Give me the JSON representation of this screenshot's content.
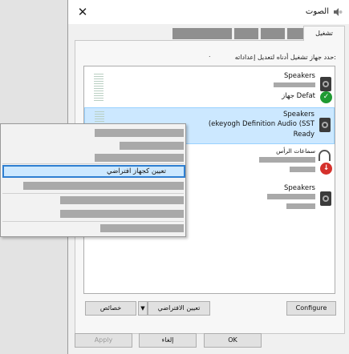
{
  "window": {
    "title": "الصوت"
  },
  "tabs": {
    "active_label": "تشغيل"
  },
  "panel": {
    "instructions": "حدد جهاز تشغيل أدناه لتعديل إعداداته:",
    "instruction_dot": "."
  },
  "devices": [
    {
      "name": "Speakers",
      "status": "جهاز Defat"
    },
    {
      "name": "Speakers",
      "detail": "(ekeyogh Definition Audio (SST",
      "status": "Ready"
    },
    {
      "name": "سماعات الرأس"
    },
    {
      "name": "Speakers"
    }
  ],
  "context_menu": {
    "highlighted_item": "تعيين كجهاز افتراضي"
  },
  "buttons": {
    "configure": "Configure",
    "set_default": "تعيين الافتراضي",
    "set_default_arrow": "▼",
    "properties": "خصائص",
    "ok": "OK",
    "cancel": "إلغاء",
    "apply": "Apply"
  },
  "colors": {
    "selection": "#cce8ff",
    "menu_highlight_border": "#2f7fd1",
    "default_badge": "#1f9a32",
    "disabled_badge": "#d5312c"
  }
}
